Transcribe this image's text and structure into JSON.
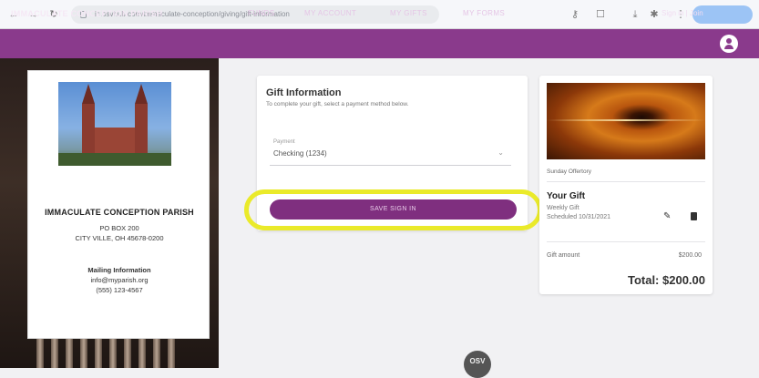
{
  "browser": {
    "back_icon": "back-arrow-icon",
    "forward_icon": "forward-arrow-icon",
    "reload_icon": "reload-icon",
    "url": "ic.osvhub.com/immaculate-conception/giving/gift-information"
  },
  "header": {
    "parish_name": "IMMACULATE CONCEPTION PARISH",
    "nav": [
      "FUNDS",
      "MY ACCOUNT",
      "MY GIFTS",
      "MY FORMS"
    ],
    "sign_in": "Sign in | Join"
  },
  "parish_card": {
    "name": "IMMACULATE CONCEPTION PARISH",
    "address_line1": "PO BOX 200",
    "address_line2": "CITY VILLE, OH 45678-0200",
    "mailing_heading": "Mailing Information",
    "email": "info@myparish.org",
    "phone": "(555) 123-4567"
  },
  "gift_form": {
    "heading": "Gift Information",
    "subheading": "To complete your gift, select a payment method below.",
    "payment_label": "Payment",
    "payment_value": "Checking (1234)",
    "add_button": "SAVE SIGN IN"
  },
  "summary": {
    "fund_name": "Sunday Offertory",
    "your_gift": "Your Gift",
    "frequency": "Weekly Gift",
    "schedule": "Scheduled 10/31/2021",
    "gift_amount_label": "Gift amount",
    "gift_amount_value": "$200.00",
    "total": "Total: $200.00"
  },
  "badge": "OSV",
  "colors": {
    "brand_purple": "#8a3a8c",
    "button_purple": "#7f2f7f",
    "highlight_yellow": "#eaea2a"
  }
}
